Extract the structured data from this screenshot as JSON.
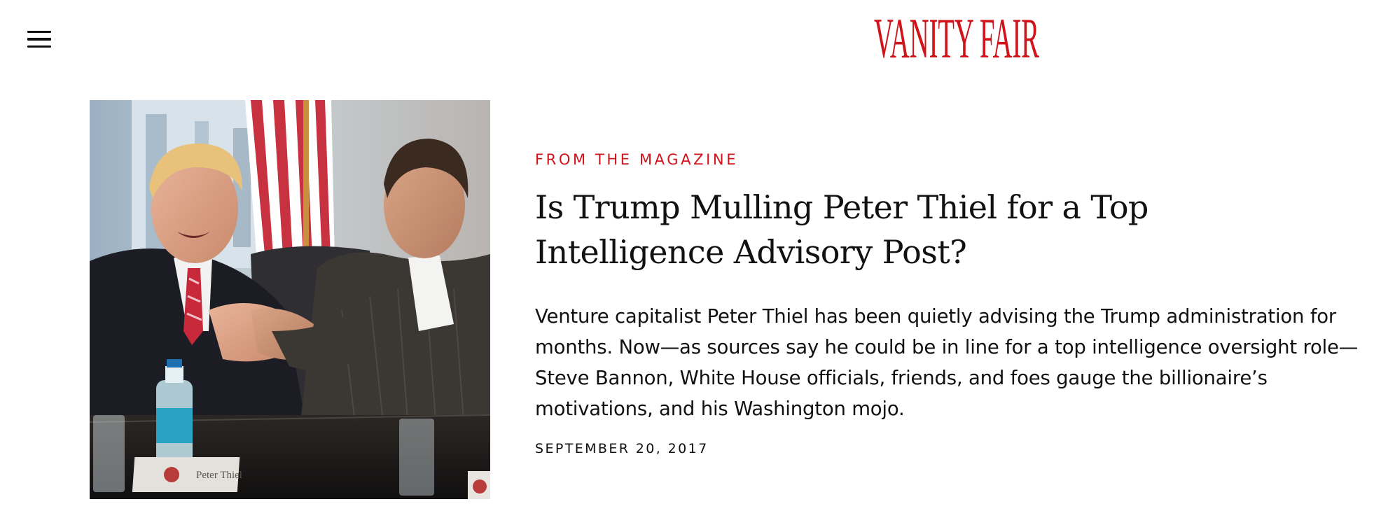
{
  "header": {
    "logo_text": "VANITY FAIR",
    "brand_color": "#D0141B",
    "menu_icon": "hamburger-menu-icon"
  },
  "article": {
    "rubric": "FROM THE MAGAZINE",
    "rubric_color": "#D0141B",
    "headline": "Is Trump Mulling Peter Thiel for a Top Intelligence Advisory Post?",
    "dek": "Venture capitalist Peter Thiel has been quietly advising the Trump administration for months. Now—as sources say he could be in line for a top intelligence oversight role—Steve Bannon, White House officials, friends, and foes gauge the billionaire’s motivations, and his Washington mojo.",
    "date": "SEPTEMBER 20, 2017",
    "image": {
      "nameplate_text": "Peter Thiel"
    }
  }
}
